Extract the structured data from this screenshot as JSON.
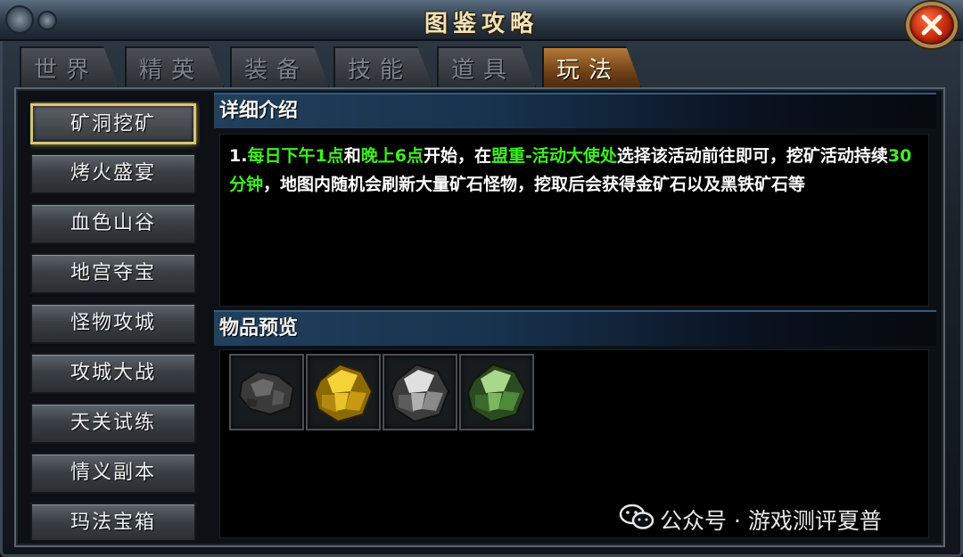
{
  "window": {
    "title": "图鉴攻略"
  },
  "tabs": [
    {
      "label": "世界",
      "active": false
    },
    {
      "label": "精英",
      "active": false
    },
    {
      "label": "装备",
      "active": false
    },
    {
      "label": "技能",
      "active": false
    },
    {
      "label": "道具",
      "active": false
    },
    {
      "label": "玩法",
      "active": true
    }
  ],
  "menu": {
    "items": [
      {
        "label": "矿洞挖矿",
        "active": true
      },
      {
        "label": "烤火盛宴",
        "active": false
      },
      {
        "label": "血色山谷",
        "active": false
      },
      {
        "label": "地宫夺宝",
        "active": false
      },
      {
        "label": "怪物攻城",
        "active": false
      },
      {
        "label": "攻城大战",
        "active": false
      },
      {
        "label": "天关试练",
        "active": false
      },
      {
        "label": "情义副本",
        "active": false
      },
      {
        "label": "玛法宝箱",
        "active": false
      }
    ]
  },
  "details": {
    "heading": "详细介绍",
    "segments": [
      {
        "text": "1.",
        "highlight": false
      },
      {
        "text": "每日下午1点",
        "highlight": true
      },
      {
        "text": "和",
        "highlight": false
      },
      {
        "text": "晚上6点",
        "highlight": true
      },
      {
        "text": "开始，在",
        "highlight": false
      },
      {
        "text": "盟重-活动大使处",
        "highlight": true
      },
      {
        "text": "选择该活动前往即可，挖矿活动持续",
        "highlight": false
      },
      {
        "text": "30分钟",
        "highlight": true
      },
      {
        "text": "，地图内随机会刷新大量矿石怪物，挖取后会获得金矿石以及黑铁矿石等",
        "highlight": false
      }
    ]
  },
  "preview": {
    "heading": "物品预览",
    "items": [
      {
        "icon": "black-iron-ore-icon",
        "color": "#4a4a4a"
      },
      {
        "icon": "gold-ore-icon",
        "color": "#d6b01c"
      },
      {
        "icon": "silver-ore-icon",
        "color": "#b9b9b9"
      },
      {
        "icon": "jade-ore-icon",
        "color": "#5f9a48"
      }
    ]
  },
  "watermark": {
    "text": "公众号 · 游戏测评夏普"
  },
  "colors": {
    "highlight": "#3cf01e",
    "active_tab": "#9a6228",
    "active_menu_border": "#d7c67a"
  }
}
